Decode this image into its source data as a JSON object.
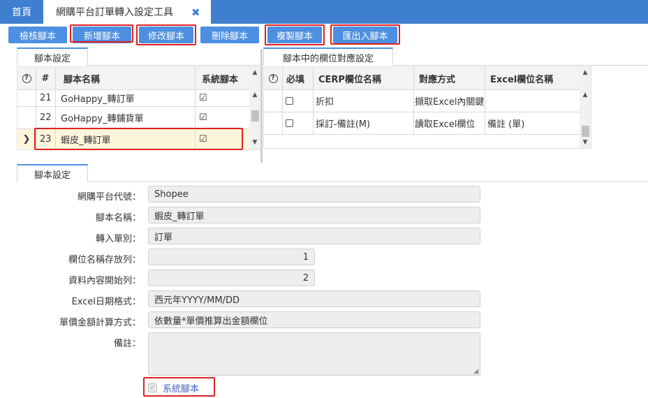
{
  "tabs": {
    "home": "首頁",
    "active": "網購平台訂單轉入設定工具",
    "close_icon": "✖"
  },
  "toolbar": {
    "check": "檢核腳本",
    "add": "新增腳本",
    "edit": "修改腳本",
    "delete": "刪除腳本",
    "copy": "複製腳本",
    "import_export": "匯出入腳本"
  },
  "left_panel": {
    "tab": "腳本設定",
    "headers": {
      "help": "?",
      "num": "#",
      "name": "腳本名稱",
      "system": "系統腳本"
    },
    "rows": [
      {
        "num": "21",
        "name": "GoHappy_轉訂單",
        "system": "☑"
      },
      {
        "num": "22",
        "name": "GoHappy_轉鋪貨單",
        "system": "☑"
      },
      {
        "num": "23",
        "name": "蝦皮_轉訂單",
        "system": "☑",
        "selected_icon": "❯"
      }
    ]
  },
  "right_panel": {
    "tab": "腳本中的欄位對應設定",
    "headers": {
      "help": "?",
      "required": "必填",
      "erp": "CERP欄位名稱",
      "method": "對應方式",
      "excel": "Excel欄位名稱"
    },
    "rows": [
      {
        "erp": "折扣",
        "method": "擷取Excel內關鍵",
        "excel": ""
      },
      {
        "erp": "採訂-備註(M)",
        "method": "讀取Excel欄位",
        "excel": "備註 (單)"
      }
    ]
  },
  "detail": {
    "tab": "腳本設定",
    "fields": [
      {
        "label": "網購平台代號：",
        "value": "Shopee"
      },
      {
        "label": "腳本名稱：",
        "value": "蝦皮_轉訂單"
      },
      {
        "label": "轉入單別：",
        "value": "訂單"
      },
      {
        "label": "欄位名稱存放列：",
        "value": "1"
      },
      {
        "label": "資料內容開始列：",
        "value": "2"
      },
      {
        "label": "Excel日期格式：",
        "value": "西元年YYYY/MM/DD"
      },
      {
        "label": "單價金額計算方式：",
        "value": "依數量*單價推算出金額欄位"
      },
      {
        "label": "備註：",
        "value": ""
      }
    ],
    "system_label": "系統腳本"
  }
}
